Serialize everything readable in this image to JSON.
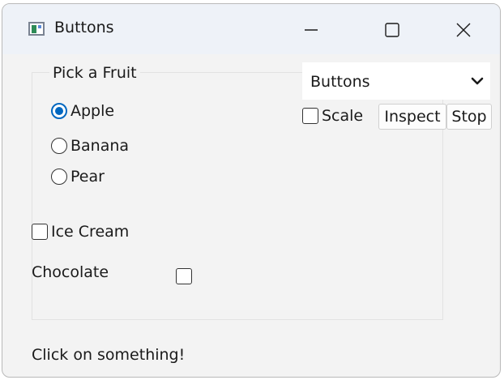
{
  "window": {
    "title": "Buttons",
    "controls": {
      "minimize": "minimize-icon",
      "maximize": "maximize-icon",
      "close": "close-icon"
    }
  },
  "fruit_group": {
    "title": "Pick a Fruit",
    "options": [
      {
        "label": "Apple",
        "checked": true
      },
      {
        "label": "Banana",
        "checked": false
      },
      {
        "label": "Pear",
        "checked": false
      }
    ]
  },
  "ice_cream": {
    "label": "Ice Cream",
    "checked": false
  },
  "chocolate": {
    "label": "Chocolate",
    "checked": false
  },
  "selector": {
    "value": "Buttons"
  },
  "toolbar": {
    "scale_label": "Scale",
    "scale_checked": false,
    "inspect_label": "Inspect",
    "stop_label": "Stop"
  },
  "status": "Click on something!",
  "colors": {
    "accent": "#0067c0",
    "titlebar": "#eef2f8",
    "background": "#f3f3f3"
  }
}
